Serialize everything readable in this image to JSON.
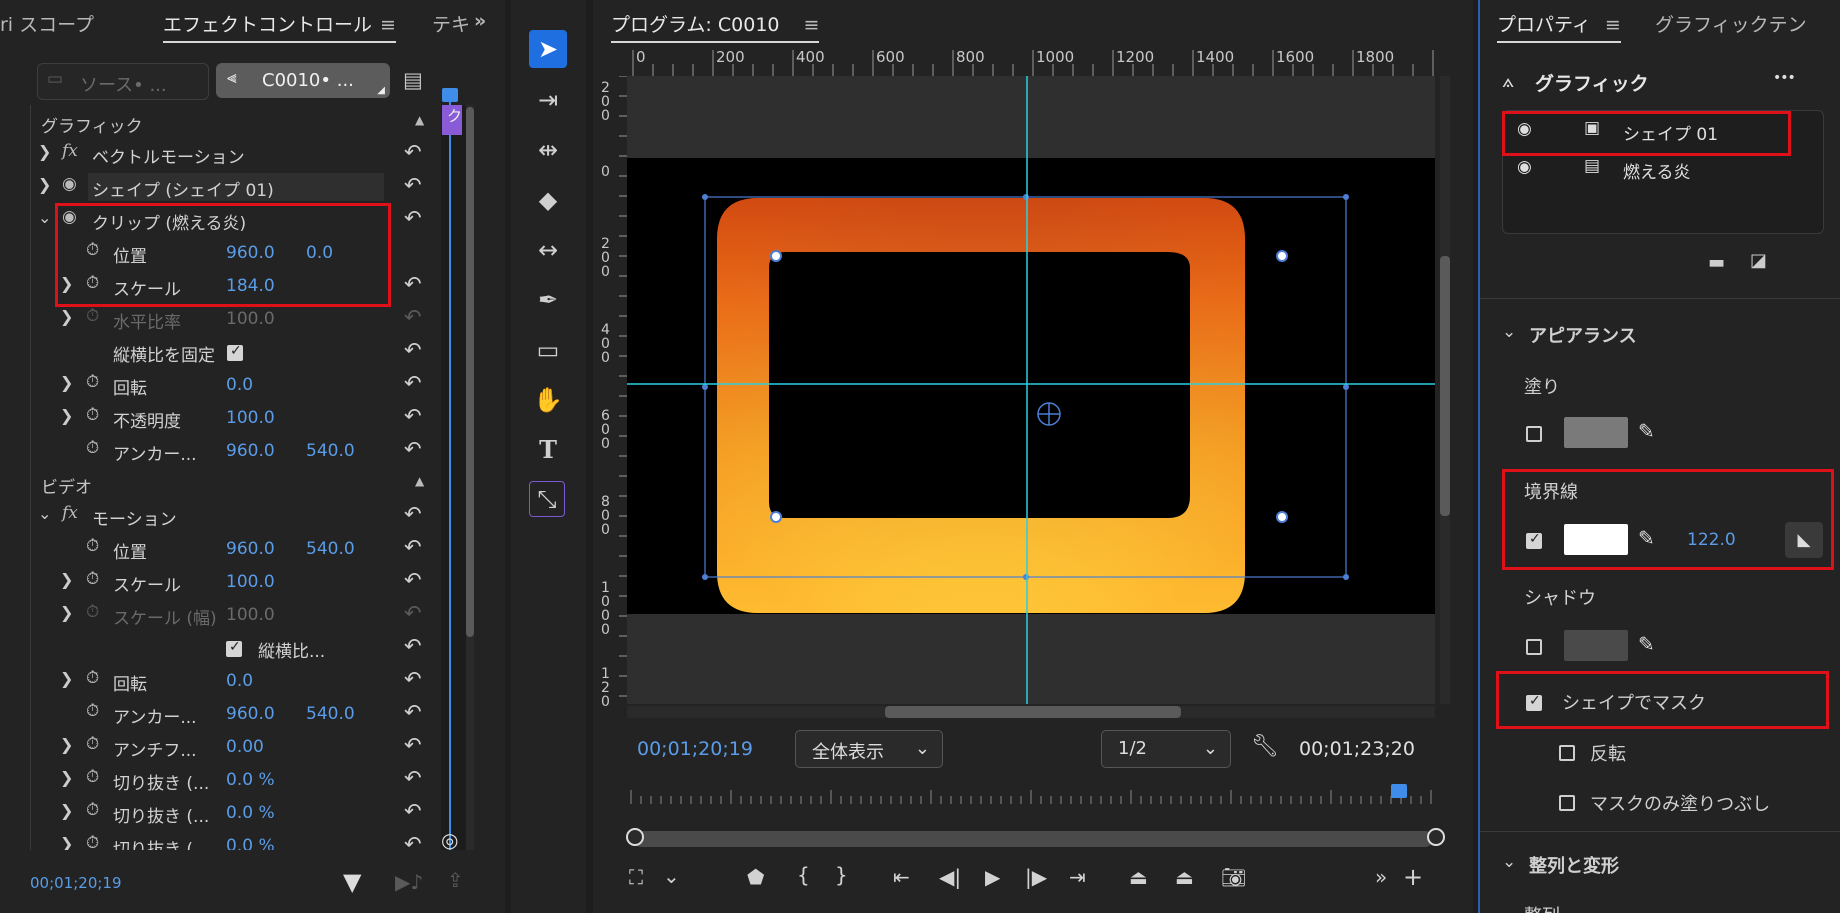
{
  "left_panel": {
    "tabs": {
      "scopes": "ri スコープ",
      "effect_controls": "エフェクトコントロール",
      "text": "テキ",
      "more": "»"
    },
    "source_selector": "ソース• ...",
    "clip_selector": "C0010• ...",
    "graphic_section": "グラフィック",
    "graphic_rows": [
      {
        "label": "ベクトルモーション"
      },
      {
        "label": "シェイプ (シェイプ 01)"
      },
      {
        "label": "クリップ (燃える炎)"
      },
      {
        "label": "位置",
        "v1": "960.0",
        "v2": "0.0"
      },
      {
        "label": "スケール",
        "v1": "184.0"
      },
      {
        "label": "水平比率",
        "v1": "100.0"
      },
      {
        "label": "縦横比を固定"
      },
      {
        "label": "回転",
        "v1": "0.0"
      },
      {
        "label": "不透明度",
        "v1": "100.0"
      },
      {
        "label": "アンカー...",
        "v1": "960.0",
        "v2": "540.0"
      }
    ],
    "video_section": "ビデオ",
    "video_rows": [
      {
        "label": "モーション"
      },
      {
        "label": "位置",
        "v1": "960.0",
        "v2": "540.0"
      },
      {
        "label": "スケール",
        "v1": "100.0"
      },
      {
        "label": "スケール (幅)",
        "v1": "100.0"
      },
      {
        "label": "縦横比..."
      },
      {
        "label": "回転",
        "v1": "0.0"
      },
      {
        "label": "アンカー...",
        "v1": "960.0",
        "v2": "540.0"
      },
      {
        "label": "アンチフ...",
        "v1": "0.00"
      },
      {
        "label": "切り抜き (...",
        "v1": "0.0 %"
      },
      {
        "label": "切り抜き (...",
        "v1": "0.0 %"
      },
      {
        "label": "切り抜き (...",
        "v1": "0.0 %"
      }
    ],
    "timecode": "00;01;20;19",
    "fx_badge": "ク"
  },
  "program": {
    "title": "プログラム: C0010",
    "ruler_labels": [
      "0",
      "200",
      "400",
      "600",
      "800",
      "1000",
      "1200",
      "1400",
      "1600",
      "1800"
    ],
    "vruler_labels": [
      "200",
      "0",
      "200",
      "400",
      "600",
      "800",
      "1000",
      "120"
    ],
    "timecode_current": "00;01;20;19",
    "zoom": "全体表示",
    "resolution": "1/2",
    "timecode_duration": "00;01;23;20",
    "playhead_fraction": 0.96
  },
  "properties": {
    "tabs": {
      "properties": "プロパティ",
      "graphic_templates": "グラフィックテン"
    },
    "graphic_label": "グラフィック",
    "more": "•••",
    "layers": [
      {
        "name": "シェイプ 01",
        "icon": "shape-layer-icon"
      },
      {
        "name": "燃える炎",
        "icon": "clip-layer-icon"
      }
    ],
    "appearance": "アピアランス",
    "fill": "塗り",
    "stroke": "境界線",
    "stroke_width": "122.0",
    "shadow": "シャドウ",
    "mask_with_shape": "シェイプでマスク",
    "invert": "反転",
    "fill_mask_only": "マスクのみ塗りつぶし",
    "align_transform": "整列と変形",
    "align": "整列",
    "colors": {
      "fill": "#7a7a7a",
      "stroke": "#ffffff",
      "shadow": "#4a4a4a",
      "accent": "#5a9ce8",
      "highlight": "#e0101a"
    }
  }
}
